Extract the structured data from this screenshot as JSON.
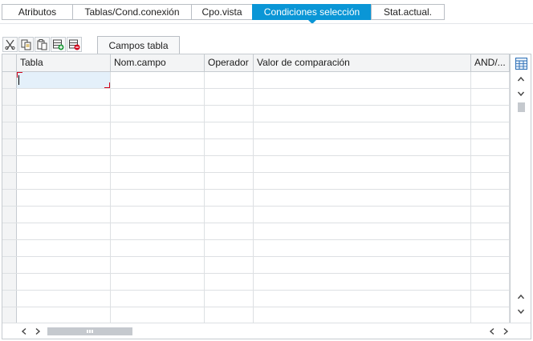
{
  "tabs": [
    {
      "label": "Atributos",
      "active": false
    },
    {
      "label": "Tablas/Cond.conexión",
      "active": false
    },
    {
      "label": "Cpo.vista",
      "active": false
    },
    {
      "label": "Condiciones selección",
      "active": true
    },
    {
      "label": "Stat.actual.",
      "active": false
    }
  ],
  "toolbar": {
    "buttons": [
      {
        "icon": "scissors-icon",
        "action": "cut"
      },
      {
        "icon": "copy-icon",
        "action": "copy"
      },
      {
        "icon": "paste-icon",
        "action": "paste"
      },
      {
        "icon": "insert-row-icon",
        "action": "insert row"
      },
      {
        "icon": "delete-row-icon",
        "action": "delete row"
      }
    ]
  },
  "inner_tab": {
    "label": "Campos tabla"
  },
  "table": {
    "columns": [
      "Tabla",
      "Nom.campo",
      "Operador",
      "Valor de comparación",
      "AND/..."
    ],
    "rows": [
      [
        "",
        "",
        "",
        "",
        ""
      ],
      [
        "",
        "",
        "",
        "",
        ""
      ],
      [
        "",
        "",
        "",
        "",
        ""
      ],
      [
        "",
        "",
        "",
        "",
        ""
      ],
      [
        "",
        "",
        "",
        "",
        ""
      ],
      [
        "",
        "",
        "",
        "",
        ""
      ],
      [
        "",
        "",
        "",
        "",
        ""
      ],
      [
        "",
        "",
        "",
        "",
        ""
      ],
      [
        "",
        "",
        "",
        "",
        ""
      ],
      [
        "",
        "",
        "",
        "",
        ""
      ],
      [
        "",
        "",
        "",
        "",
        ""
      ],
      [
        "",
        "",
        "",
        "",
        ""
      ],
      [
        "",
        "",
        "",
        "",
        ""
      ],
      [
        "",
        "",
        "",
        "",
        ""
      ],
      [
        "",
        "",
        "",
        "",
        ""
      ]
    ],
    "focused_cell": {
      "row": 0,
      "column": 0
    }
  },
  "colors": {
    "active_tab": "#0a96d6",
    "focus_cell": "#e4f0fa",
    "focus_marker": "#d0021b",
    "add_icon": "#1e9a3a",
    "delete_icon": "#d0021b"
  }
}
